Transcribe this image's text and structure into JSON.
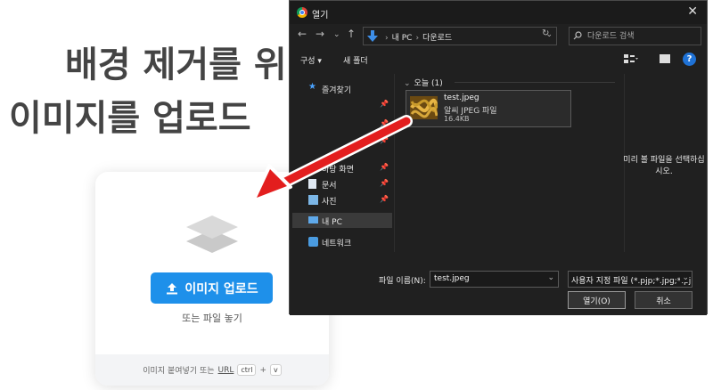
{
  "page": {
    "title_line1": "배경 제거를 위",
    "title_line2": "이미지를 업로드",
    "upload_button": "이미지 업로드",
    "drop_hint": "또는 파일 놓기",
    "paste_text": "이미지 붙여넣기 또는",
    "url_link": "URL",
    "kbd_ctrl": "ctrl",
    "kbd_plus": "+",
    "kbd_v": "v"
  },
  "dialog": {
    "title": "열기",
    "close": "✕",
    "address": {
      "crumb1": "내 PC",
      "crumb2": "다운로드"
    },
    "search_placeholder": "다운로드 검색",
    "toolbar": {
      "organize": "구성 ▾",
      "new_folder": "새 폴더",
      "help": "?"
    },
    "nav": {
      "quick_access": "즐겨찾기",
      "desktop": "바탕 화면",
      "documents": "문서",
      "pictures": "사진",
      "this_pc": "내 PC",
      "network": "네트워크"
    },
    "group_header": "오늘 (1)",
    "file": {
      "name": "test.jpeg",
      "type": "알씨 JPEG 파일",
      "size": "16.4KB"
    },
    "preview_text": "미리 볼 파일을 선택하십시오.",
    "filename_label": "파일 이름(N):",
    "filename_value": "test.jpeg",
    "filetype_value": "사용자 지정 파일 (*.pjp;*.jpg;*.pjpeg;*.jpeg;*.jfif)",
    "open_button": "열기(O)",
    "cancel_button": "취소"
  },
  "colors": {
    "accent": "#1e90ea",
    "dialog_bg": "#202020",
    "arrow": "#e31e1e"
  }
}
